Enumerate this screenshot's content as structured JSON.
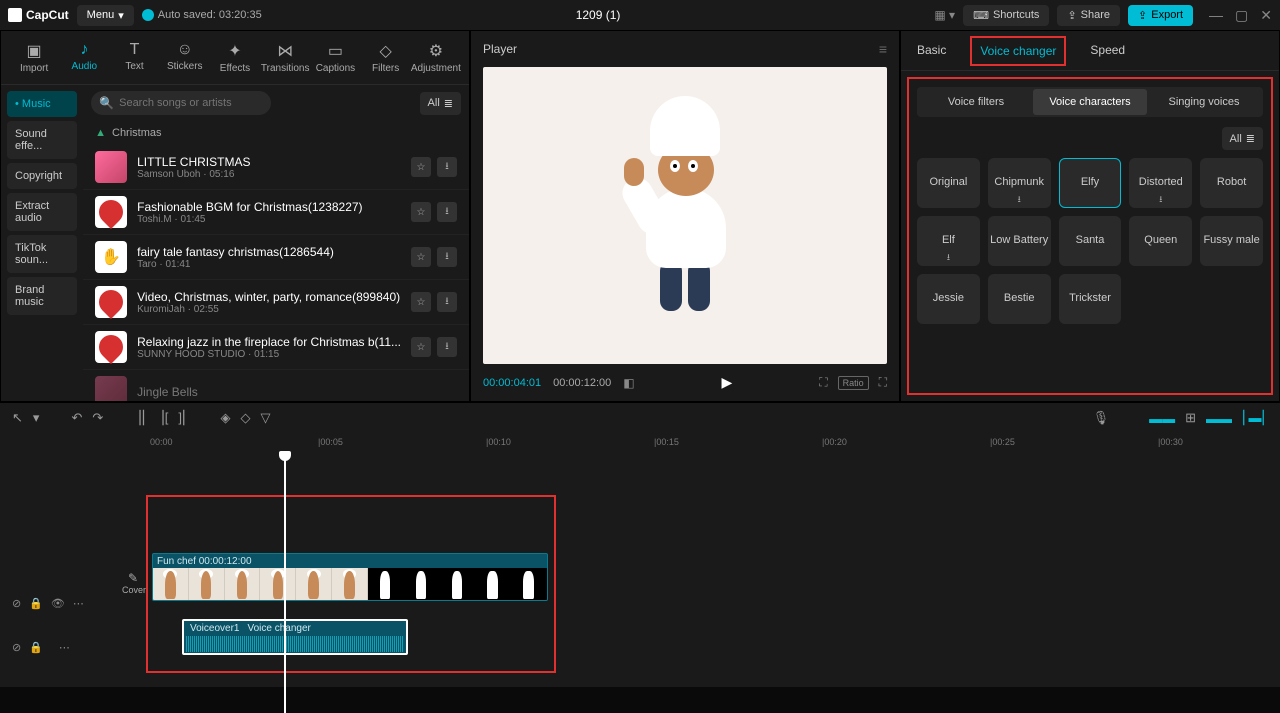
{
  "app": {
    "name": "CapCut",
    "menu_label": "Menu",
    "autosave": "Auto saved: 03:20:35",
    "project_title": "1209 (1)"
  },
  "titlebar": {
    "shortcuts": "Shortcuts",
    "share": "Share",
    "export": "Export"
  },
  "tools": {
    "import": "Import",
    "audio": "Audio",
    "text": "Text",
    "stickers": "Stickers",
    "effects": "Effects",
    "transitions": "Transitions",
    "captions": "Captions",
    "filters": "Filters",
    "adjustment": "Adjustment"
  },
  "sidebar": {
    "music": "Music",
    "sound_effects": "Sound effe...",
    "copyright": "Copyright",
    "extract_audio": "Extract audio",
    "tiktok": "TikTok soun...",
    "brand": "Brand music"
  },
  "search": {
    "placeholder": "Search songs or artists",
    "filter_all": "All"
  },
  "category": "Christmas",
  "songs": [
    {
      "title": "LITTLE CHRISTMAS",
      "meta": "Samson Uboh · 05:16"
    },
    {
      "title": "Fashionable BGM for Christmas(1238227)",
      "meta": "Toshi.M · 01:45"
    },
    {
      "title": "fairy tale fantasy christmas(1286544)",
      "meta": "Taro · 01:41"
    },
    {
      "title": "Video, Christmas, winter, party, romance(899840)",
      "meta": "KuromiJah · 02:55"
    },
    {
      "title": "Relaxing jazz in the fireplace for Christmas b(11...",
      "meta": "SUNNY HOOD STUDIO · 01:15"
    },
    {
      "title": "Jingle Bells",
      "meta": ""
    }
  ],
  "player": {
    "label": "Player",
    "time_current": "00:00:04:01",
    "time_total": "00:00:12:00",
    "ratio": "Ratio"
  },
  "right_tabs": {
    "basic": "Basic",
    "voice_changer": "Voice changer",
    "speed": "Speed"
  },
  "voice_tabs": {
    "filters": "Voice filters",
    "characters": "Voice characters",
    "singing": "Singing voices"
  },
  "voices": {
    "all": "All",
    "items": [
      "Original",
      "Chipmunk",
      "Elfy",
      "Distorted",
      "Robot",
      "Elf",
      "Low Battery",
      "Santa",
      "Queen",
      "Fussy male",
      "Jessie",
      "Bestie",
      "Trickster"
    ]
  },
  "timeline": {
    "ticks": [
      "00:00",
      "|00:05",
      "|00:10",
      "|00:15",
      "|00:20",
      "|00:25",
      "|00:30"
    ],
    "cover": "Cover",
    "clip_label": "Fun chef  00:00:12:00",
    "audio_name": "Voiceover1",
    "audio_effect": "Voice changer"
  }
}
